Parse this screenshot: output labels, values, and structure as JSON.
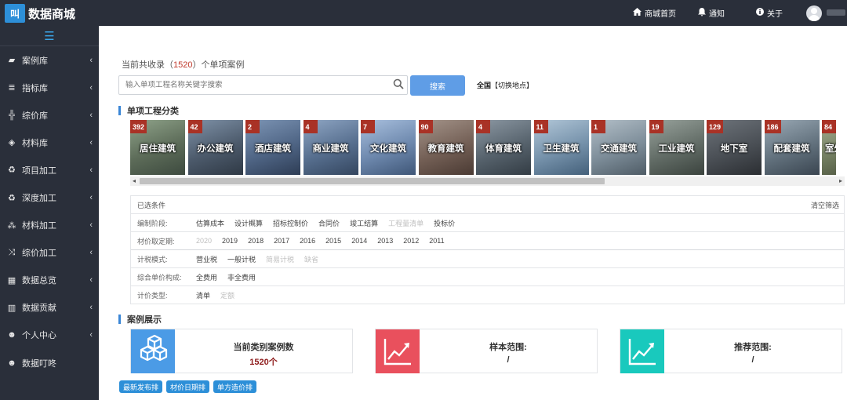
{
  "header": {
    "logo_mark": "叫",
    "logo_text": "数据商城",
    "nav": [
      {
        "icon": "home-icon",
        "label": "商城首页"
      },
      {
        "icon": "bell-icon",
        "label": "通知"
      },
      {
        "icon": "info-icon",
        "label": "关于"
      }
    ]
  },
  "sidebar": {
    "items": [
      {
        "icon": "book-icon",
        "label": "案例库"
      },
      {
        "icon": "database-icon",
        "label": "指标库"
      },
      {
        "icon": "sitemap-icon",
        "label": "综价库"
      },
      {
        "icon": "cube-icon",
        "label": "材料库"
      },
      {
        "icon": "recycle-icon",
        "label": "项目加工"
      },
      {
        "icon": "recycle-icon",
        "label": "深度加工"
      },
      {
        "icon": "cubes-icon",
        "label": "材料加工"
      },
      {
        "icon": "shuffle-icon",
        "label": "综价加工"
      },
      {
        "icon": "grid-icon",
        "label": "数据总览"
      },
      {
        "icon": "bar-chart-icon",
        "label": "数据贡献"
      },
      {
        "icon": "user-circle-icon",
        "label": "个人中心"
      },
      {
        "icon": "user-circle-icon",
        "label": "数据叮咚"
      }
    ]
  },
  "summary": {
    "prefix": "当前共收录（",
    "count": "1520",
    "suffix": "）个单项案例"
  },
  "search": {
    "placeholder": "输入单项工程名称关键字搜索",
    "button_label": "搜索",
    "region_all": "全国",
    "region_switch": "【切换地点】"
  },
  "category_section": {
    "title": "单项工程分类",
    "items": [
      {
        "count": "392",
        "label": "居住建筑",
        "color": "#6b7a6a"
      },
      {
        "count": "42",
        "label": "办公建筑",
        "color": "#4e5d70"
      },
      {
        "count": "2",
        "label": "酒店建筑",
        "color": "#556b86"
      },
      {
        "count": "4",
        "label": "商业建筑",
        "color": "#5a6e8a"
      },
      {
        "count": "7",
        "label": "文化建筑",
        "color": "#6d86a8"
      },
      {
        "count": "90",
        "label": "教育建筑",
        "color": "#7a6a62"
      },
      {
        "count": "4",
        "label": "体育建筑",
        "color": "#59656f"
      },
      {
        "count": "11",
        "label": "卫生建筑",
        "color": "#6f8aa0"
      },
      {
        "count": "1",
        "label": "交通建筑",
        "color": "#7b8a96"
      },
      {
        "count": "19",
        "label": "工业建筑",
        "color": "#5f6863"
      },
      {
        "count": "129",
        "label": "地下室",
        "color": "#4a4f55"
      },
      {
        "count": "186",
        "label": "配套建筑",
        "color": "#5c6f7d"
      },
      {
        "count": "84",
        "label": "室外",
        "color": "#6f7a5d"
      }
    ]
  },
  "filters": {
    "selected_label": "已选条件",
    "clear_label": "清空筛选",
    "rows": [
      {
        "label": "编制阶段:",
        "options": [
          {
            "text": "估算成本",
            "disabled": false
          },
          {
            "text": "设计概算",
            "disabled": false
          },
          {
            "text": "招标控制价",
            "disabled": false
          },
          {
            "text": "合同价",
            "disabled": false
          },
          {
            "text": "竣工结算",
            "disabled": false
          },
          {
            "text": "工程量清单",
            "disabled": true
          },
          {
            "text": "投标价",
            "disabled": false
          }
        ]
      },
      {
        "label": "材价取定期:",
        "options": [
          {
            "text": "2020",
            "disabled": true
          },
          {
            "text": "2019",
            "disabled": false
          },
          {
            "text": "2018",
            "disabled": false
          },
          {
            "text": "2017",
            "disabled": false
          },
          {
            "text": "2016",
            "disabled": false
          },
          {
            "text": "2015",
            "disabled": false
          },
          {
            "text": "2014",
            "disabled": false
          },
          {
            "text": "2013",
            "disabled": false
          },
          {
            "text": "2012",
            "disabled": false
          },
          {
            "text": "2011",
            "disabled": false
          }
        ]
      },
      {
        "label": "计税模式:",
        "options": [
          {
            "text": "营业税",
            "disabled": false
          },
          {
            "text": "一般计税",
            "disabled": false
          },
          {
            "text": "简易计税",
            "disabled": true
          },
          {
            "text": "缺省",
            "disabled": true
          }
        ]
      },
      {
        "label": "综合单价构成:",
        "options": [
          {
            "text": "全费用",
            "disabled": false
          },
          {
            "text": "非全费用",
            "disabled": false
          }
        ]
      },
      {
        "label": "计价类型:",
        "options": [
          {
            "text": "清单",
            "disabled": false
          },
          {
            "text": "定额",
            "disabled": true
          }
        ]
      }
    ]
  },
  "showcase": {
    "title": "案例展示",
    "cards": [
      {
        "icon": "cubes-icon",
        "color": "#4b9be6",
        "title": "当前类别案例数",
        "value": "1520个"
      },
      {
        "icon": "trend-up-icon",
        "color": "#e9505d",
        "title": "样本范围:",
        "value": "/"
      },
      {
        "icon": "trend-up-icon",
        "color": "#19c9bd",
        "title": "推荐范围:",
        "value": "/"
      }
    ],
    "sort_buttons": [
      "最新发布排",
      "材价日期排",
      "单方造价排"
    ]
  }
}
